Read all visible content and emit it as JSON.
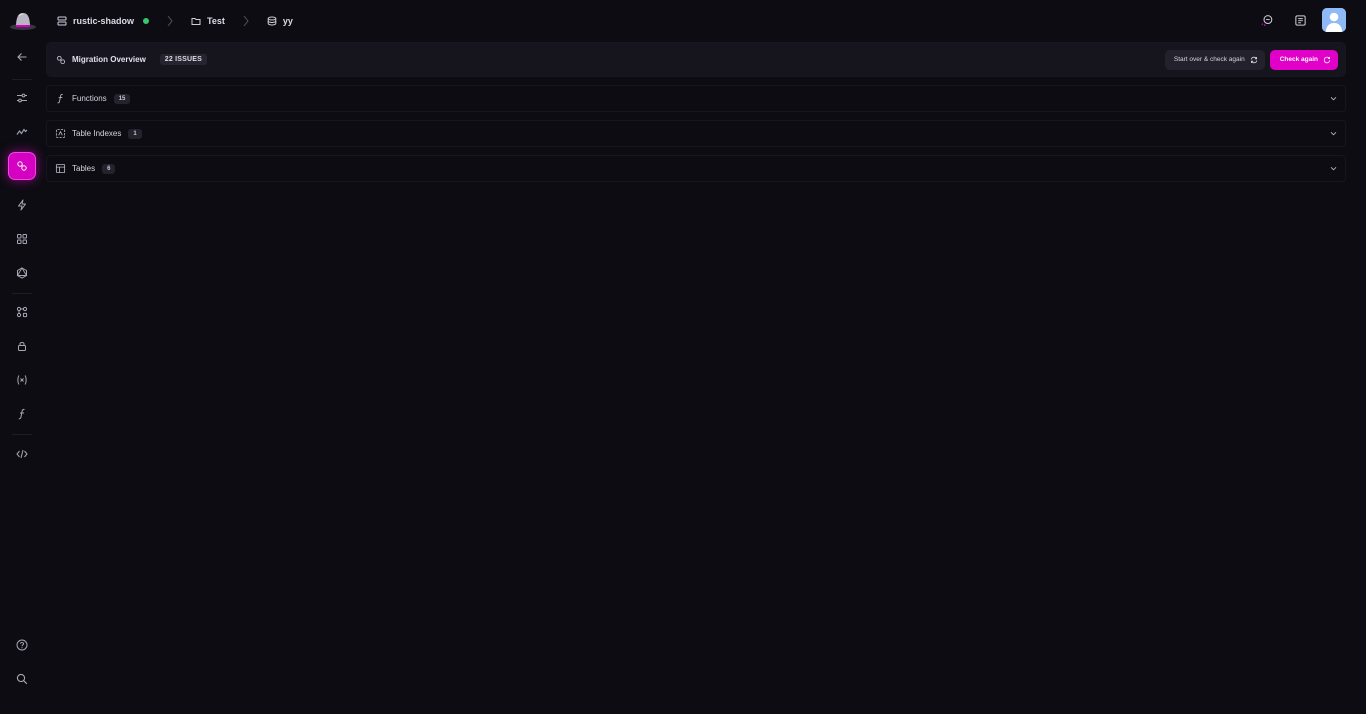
{
  "breadcrumb": {
    "project": "rustic-shadow",
    "folder": "Test",
    "database": "yy"
  },
  "overview": {
    "title": "Migration Overview",
    "issues_badge": "22 ISSUES",
    "start_over_label": "Start over & check again",
    "check_again_label": "Check again"
  },
  "sections": [
    {
      "label": "Functions",
      "count": "15",
      "icon": "function-icon"
    },
    {
      "label": "Table Indexes",
      "count": "1",
      "icon": "index-icon"
    },
    {
      "label": "Tables",
      "count": "6",
      "icon": "table-icon"
    }
  ],
  "sidebar": {
    "items": [
      "back-arrow-icon",
      "sliders-icon",
      "activity-icon",
      "migration-icon",
      "lightning-icon",
      "grid-icon",
      "graphql-icon",
      "components-icon",
      "lock-icon",
      "variables-icon",
      "function-icon",
      "code-icon",
      "help-icon",
      "search-icon"
    ],
    "active": "migration-icon"
  },
  "colors": {
    "background": "#0d0c12",
    "accent": "#e000c8",
    "status_online": "#36c76a",
    "panel": "#16151d"
  }
}
